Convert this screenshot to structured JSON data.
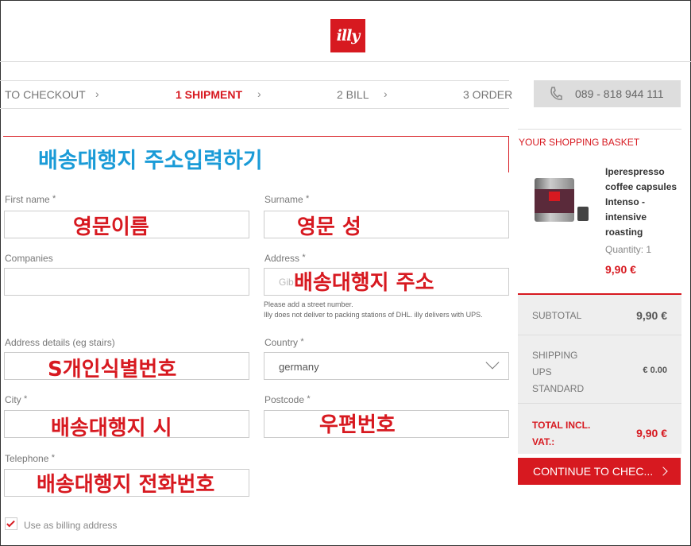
{
  "brand": {
    "logo_text": "illy",
    "color": "#d71920"
  },
  "steps": [
    {
      "label": "TO CHECKOUT"
    },
    {
      "label": "1 SHIPMENT"
    },
    {
      "label": "2 BILL"
    },
    {
      "label": "3 ORDER"
    }
  ],
  "phone": {
    "icon": "phone-icon",
    "number": "089 - 818 944 111"
  },
  "form": {
    "first_name_label": "First name",
    "surname_label": "Surname",
    "companies_label": "Companies",
    "address_label": "Address",
    "address_placeholder": "Gib",
    "address_hint_1": "Please add a street number.",
    "address_hint_2": "Illy does not deliver to packing stations of DHL. illy delivers with UPS.",
    "address_details_label": "Address details (eg stairs)",
    "country_label": "Country",
    "country_value": "germany",
    "city_label": "City",
    "postcode_label": "Postcode",
    "telephone_label": "Telephone",
    "required_mark": "*",
    "billing_checkbox_label": "Use as billing address",
    "billing_checked": true
  },
  "annotations": {
    "title": "배송대행지 주소입력하기",
    "first_name": "영문이름",
    "surname": "영문 성",
    "address": "배송대행지 주소",
    "address_details": "S개인식별번호",
    "city": "배송대행지 시",
    "postcode": "우편번호",
    "telephone": "배송대행지 전화번호"
  },
  "basket": {
    "title": "YOUR SHOPPING BASKET",
    "product_name": "Iperespresso coffee capsules Intenso - intensive roasting",
    "quantity": "Quantity: 1",
    "price": "9,90 €",
    "subtotal_label": "SUBTOTAL",
    "subtotal_value": "9,90 €",
    "shipping_label_1": "SHIPPING",
    "shipping_label_2": "UPS",
    "shipping_label_3": "STANDARD",
    "shipping_value": "€ 0.00",
    "total_label_1": "TOTAL INCL.",
    "total_label_2": "VAT.:",
    "total_value": "9,90 €",
    "cta_label": "CONTINUE TO CHEC..."
  }
}
